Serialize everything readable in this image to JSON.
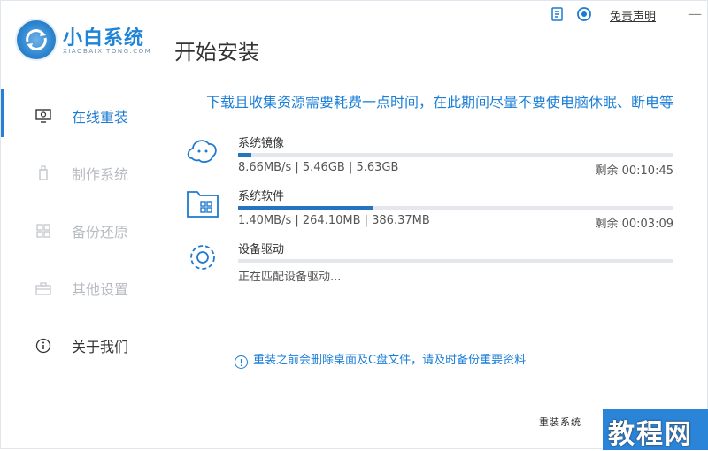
{
  "app": {
    "brand_name": "小白系统",
    "brand_subtitle": "XIAOBAIXITONG.COM",
    "page_title": "开始安装"
  },
  "topbar": {
    "disclaimer_label": "免责声明",
    "close_glyph": "—"
  },
  "sidebar": {
    "items": [
      {
        "label": "在线重装",
        "icon": "monitor-icon",
        "state": "active"
      },
      {
        "label": "制作系统",
        "icon": "usb-icon",
        "state": "disabled"
      },
      {
        "label": "备份还原",
        "icon": "grid-icon",
        "state": "disabled"
      },
      {
        "label": "其他设置",
        "icon": "toolbox-icon",
        "state": "disabled"
      },
      {
        "label": "关于我们",
        "icon": "info-icon",
        "state": "normal"
      }
    ]
  },
  "main": {
    "notice": "下载且收集资源需要耗费一点时间，在此期间尽量不要使电脑休眠、断电等",
    "tasks": [
      {
        "name": "系统镜像",
        "icon": "cloud-face-icon",
        "progress": 0.03,
        "speed": "8.66MB/s | 5.46GB | 5.63GB",
        "remaining": "剩余 00:10:45"
      },
      {
        "name": "系统软件",
        "icon": "folder-apps-icon",
        "progress": 0.31,
        "speed": "1.40MB/s | 264.10MB | 386.37MB",
        "remaining": "剩余 00:03:09"
      },
      {
        "name": "设备驱动",
        "icon": "gear-icon",
        "progress": 0.0,
        "speed": "正在匹配设备驱动...",
        "remaining": ""
      }
    ],
    "warning": "重装之前会删除桌面及C盘文件，请及时备份重要资料"
  },
  "footer": {
    "left_text": "重装系统",
    "watermark": "教程网"
  },
  "colors": {
    "accent": "#1e7ad0",
    "progress": "#2474c4",
    "track": "#e4e8ec",
    "disabled": "#b8bcc2"
  }
}
